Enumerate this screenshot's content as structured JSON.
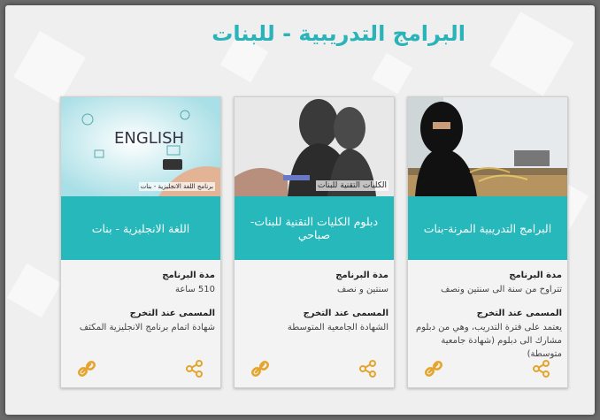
{
  "page": {
    "title": "البرامج التدريبية - للبنات"
  },
  "cards": [
    {
      "band": "البرامج التدريبية المرنة-بنات",
      "duration_label": "مدة البرنامج",
      "duration_value": "تتراوح من سنة الى سنتين ونصف",
      "grad_label": "المسمى عند التخرج",
      "grad_value": "يعتمد على فترة التدريب، وهي من دبلوم مشارك الى دبلوم (شهادة جامعية متوسطة)",
      "image_caption": ""
    },
    {
      "band": "دبلوم الكليات التقنية للبنات-صباحي",
      "duration_label": "مدة البرنامج",
      "duration_value": "سنتين و نصف",
      "grad_label": "المسمى عند التخرج",
      "grad_value": "الشهادة الجامعية المتوسطة",
      "image_caption": "الكليات التقنية للبنات"
    },
    {
      "band": "اللغة الانجليزية - بنات",
      "duration_label": "مدة البرنامج",
      "duration_value": "510 ساعة",
      "grad_label": "المسمى عند التخرج",
      "grad_value": "شهادة اتمام برنامج الانجليزية المكثف",
      "image_caption": "برنامج اللغة الانجليزية - بنات",
      "image_word": "ENGLISH"
    }
  ],
  "colors": {
    "accent": "#26b8bb",
    "icon": "#e5a52c"
  }
}
